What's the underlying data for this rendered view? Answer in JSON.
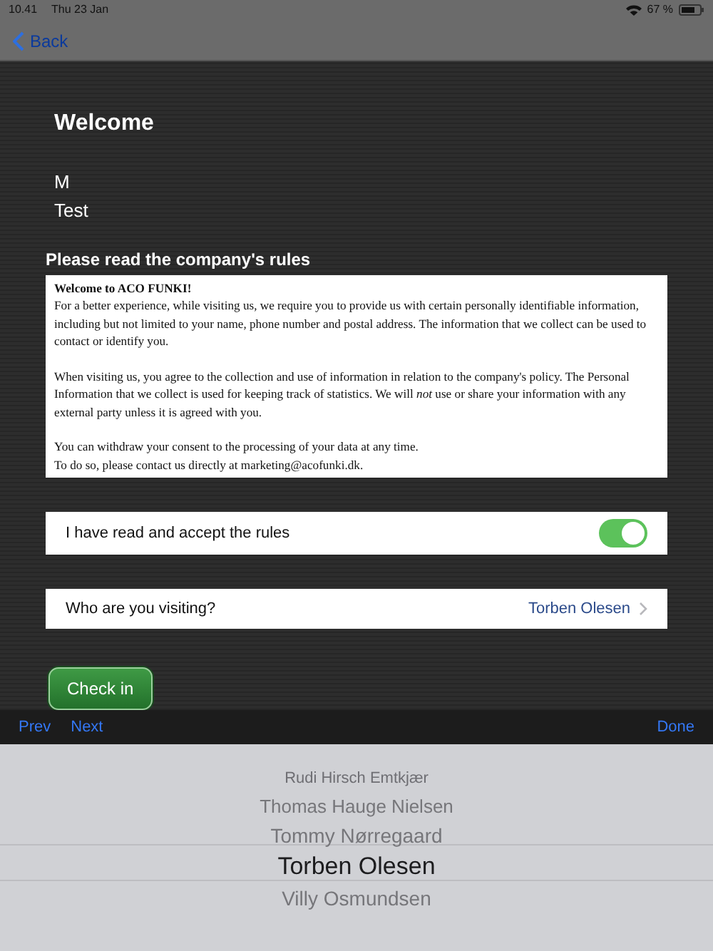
{
  "status_bar": {
    "time": "10.41",
    "date": "Thu 23 Jan",
    "battery": "67 %"
  },
  "nav": {
    "back": "Back"
  },
  "welcome": {
    "title": "Welcome",
    "lines": [
      "M",
      "Test"
    ]
  },
  "rules": {
    "heading": "Please read the company's rules",
    "title": "Welcome to ACO FUNKI!",
    "paragraphs": [
      "For a better experience, while visiting us, we require you to provide us with certain personally identifiable information, including but not limited to your name, phone number and postal address. The information that we collect can be used to contact or identify you.",
      "When visiting us, you agree to the collection and use of information in relation to the company's policy. The Personal Information that we collect is used for keeping track of statistics. We will *not* use or share your information with any external party unless it is agreed with you.",
      "You can withdraw your consent to the processing of your data at any time.",
      "To do so, please contact us directly at marketing@acofunki.dk."
    ]
  },
  "accept": {
    "label": "I have read and accept the rules",
    "on": true
  },
  "visiting": {
    "label": "Who are you visiting?",
    "value": "Torben Olesen"
  },
  "check_in": "Check in",
  "toolbar": {
    "prev": "Prev",
    "next": "Next",
    "done": "Done"
  },
  "picker": [
    {
      "label": "Rudi Hirsch Emtkjær",
      "selected": false
    },
    {
      "label": "Thomas Hauge Nielsen",
      "selected": false
    },
    {
      "label": "Tommy Nørregaard",
      "selected": false
    },
    {
      "label": "Torben Olesen",
      "selected": true
    },
    {
      "label": "Villy Osmundsen",
      "selected": false
    }
  ]
}
